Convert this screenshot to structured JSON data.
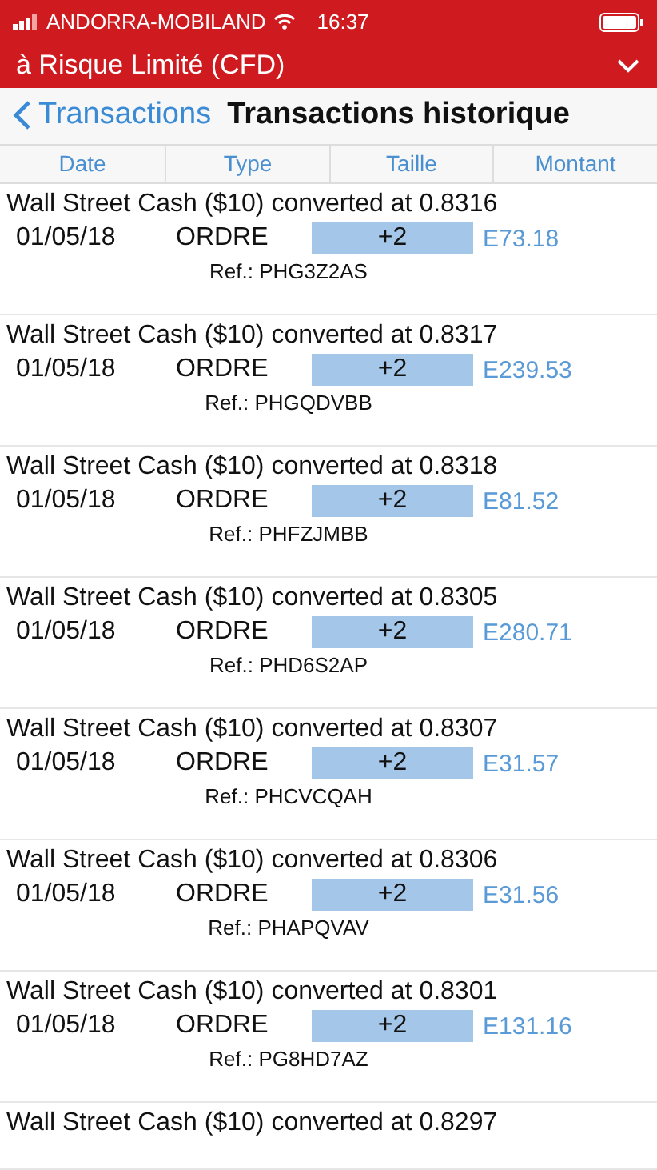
{
  "status_bar": {
    "carrier": "ANDORRA-MOBILAND",
    "time": "16:37"
  },
  "account_bar": {
    "title": "à Risque Limité (CFD)"
  },
  "nav": {
    "back": "Transactions",
    "title": "Transactions historique"
  },
  "columns": [
    "Date",
    "Type",
    "Taille",
    "Montant"
  ],
  "rows": [
    {
      "title": "Wall Street Cash ($10) converted at 0.8316",
      "date": "01/05/18",
      "type": "ORDRE",
      "size": "+2",
      "amount": "E73.18",
      "ref": "Ref.: PHG3Z2AS"
    },
    {
      "title": "Wall Street Cash ($10) converted at 0.8317",
      "date": "01/05/18",
      "type": "ORDRE",
      "size": "+2",
      "amount": "E239.53",
      "ref": "Ref.: PHGQDVBB"
    },
    {
      "title": "Wall Street Cash ($10) converted at 0.8318",
      "date": "01/05/18",
      "type": "ORDRE",
      "size": "+2",
      "amount": "E81.52",
      "ref": "Ref.: PHFZJMBB"
    },
    {
      "title": "Wall Street Cash ($10) converted at 0.8305",
      "date": "01/05/18",
      "type": "ORDRE",
      "size": "+2",
      "amount": "E280.71",
      "ref": "Ref.: PHD6S2AP"
    },
    {
      "title": "Wall Street Cash ($10) converted at 0.8307",
      "date": "01/05/18",
      "type": "ORDRE",
      "size": "+2",
      "amount": "E31.57",
      "ref": "Ref.: PHCVCQAH"
    },
    {
      "title": "Wall Street Cash ($10) converted at 0.8306",
      "date": "01/05/18",
      "type": "ORDRE",
      "size": "+2",
      "amount": "E31.56",
      "ref": "Ref.: PHAPQVAV"
    },
    {
      "title": "Wall Street Cash ($10) converted at 0.8301",
      "date": "01/05/18",
      "type": "ORDRE",
      "size": "+2",
      "amount": "E131.16",
      "ref": "Ref.: PG8HD7AZ"
    },
    {
      "title": "Wall Street Cash ($10) converted at 0.8297"
    }
  ]
}
